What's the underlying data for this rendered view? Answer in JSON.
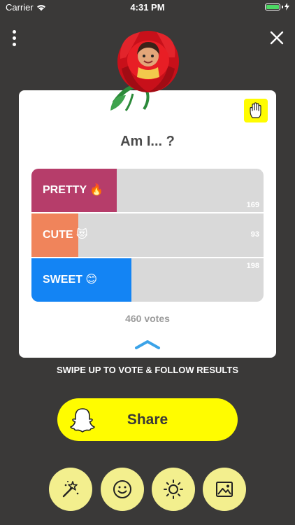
{
  "status_bar": {
    "carrier": "Carrier",
    "time": "4:31 PM"
  },
  "card": {
    "question": "Am I... ?",
    "options": [
      {
        "label": "PRETTY 🔥",
        "count": "169",
        "fraction": 0.367,
        "color": "#b63d6a"
      },
      {
        "label": "CUTE 😻",
        "count": "93",
        "fraction": 0.202,
        "color": "#f0845b"
      },
      {
        "label": "SWEET 😊",
        "count": "198",
        "fraction": 0.43,
        "color": "#1384f4"
      }
    ],
    "votes_label": "460 votes"
  },
  "swipe_hint": "SWIPE UP TO VOTE & FOLLOW RESULTS",
  "share_button": {
    "label": "Share",
    "icon": "snapchat-ghost-icon"
  },
  "bottom_toolbar": [
    {
      "icon": "magic-wand-icon"
    },
    {
      "icon": "smiley-icon"
    },
    {
      "icon": "brightness-icon"
    },
    {
      "icon": "image-icon"
    }
  ],
  "colors": {
    "background": "#3a3938",
    "accent_yellow": "#fffc00",
    "button_yellow": "#f3ef8e"
  }
}
